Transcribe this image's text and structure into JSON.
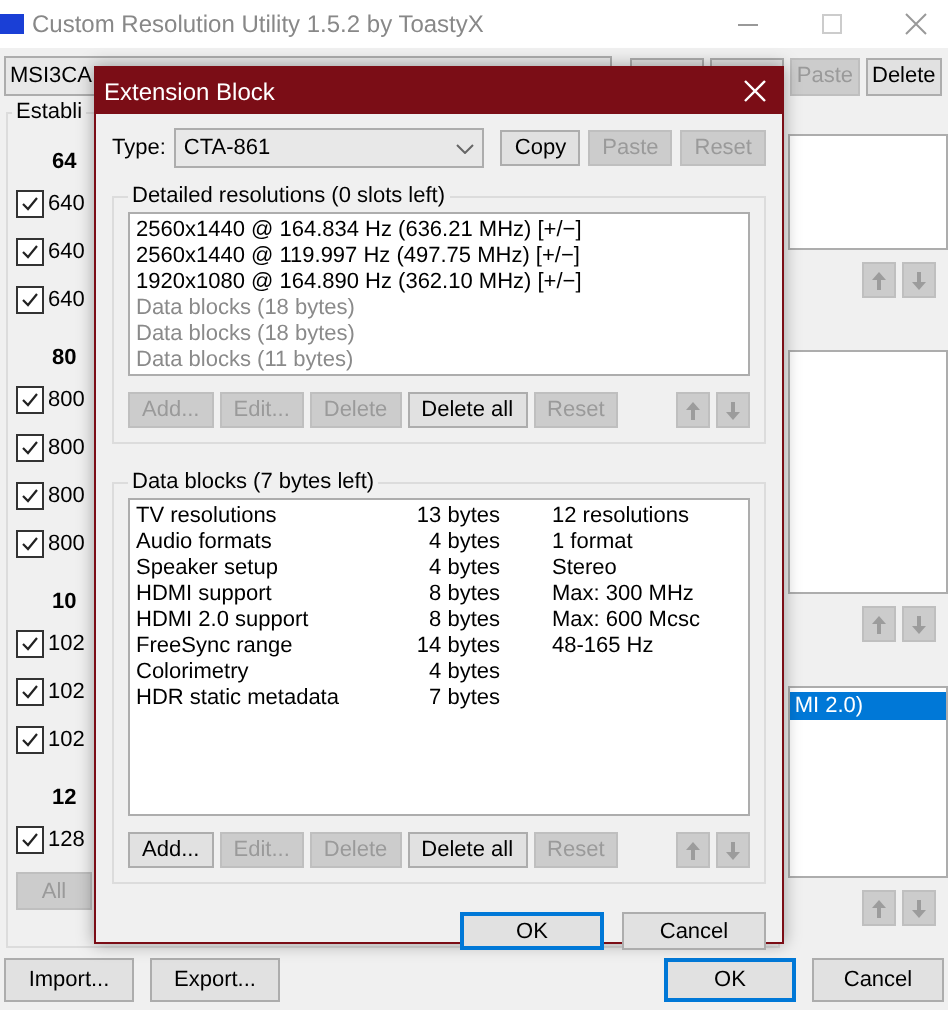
{
  "window": {
    "title": "Custom Resolution Utility 1.5.2 by ToastyX"
  },
  "toolbar": {
    "monitor": "MSI3CA",
    "buttons": [
      {
        "disabled": false
      },
      {
        "disabled": false
      },
      {
        "label": "Paste",
        "disabled": true
      },
      {
        "label": "Delete",
        "disabled": false
      }
    ]
  },
  "established": {
    "title": "Establi",
    "groups": [
      {
        "heading": "64",
        "items": [
          {
            "label": "640",
            "checked": true
          },
          {
            "label": "640",
            "checked": true
          },
          {
            "label": "640",
            "checked": true
          }
        ]
      },
      {
        "heading": "80",
        "items": [
          {
            "label": "800",
            "checked": true
          },
          {
            "label": "800",
            "checked": true
          },
          {
            "label": "800",
            "checked": true
          },
          {
            "label": "800",
            "checked": true
          }
        ]
      },
      {
        "heading": "10",
        "items": [
          {
            "label": "102",
            "checked": true
          },
          {
            "label": "102",
            "checked": true
          },
          {
            "label": "102",
            "checked": true
          }
        ]
      },
      {
        "heading": "12",
        "items": [
          {
            "label": "128",
            "checked": true
          }
        ]
      }
    ],
    "all_button": {
      "label": "All",
      "disabled": true
    }
  },
  "right_panel": {
    "extension_blocks": [
      {
        "label": "MI 2.0)",
        "selected": true
      }
    ]
  },
  "dialog": {
    "title": "Extension Block",
    "type": {
      "label": "Type:",
      "value": "CTA-861",
      "buttons": [
        {
          "label": "Copy",
          "disabled": false
        },
        {
          "label": "Paste",
          "disabled": true
        },
        {
          "label": "Reset",
          "disabled": true
        }
      ]
    },
    "detailed": {
      "title": "Detailed resolutions (0 slots left)",
      "items": [
        {
          "text": "2560x1440 @ 164.834 Hz (636.21 MHz) [+/−]",
          "kind": "resolution"
        },
        {
          "text": "2560x1440 @ 119.997 Hz (497.75 MHz) [+/−]",
          "kind": "resolution"
        },
        {
          "text": "1920x1080 @ 164.890 Hz (362.10 MHz) [+/−]",
          "kind": "resolution"
        },
        {
          "text": "Data blocks (18 bytes)",
          "kind": "data"
        },
        {
          "text": "Data blocks (18 bytes)",
          "kind": "data"
        },
        {
          "text": "Data blocks (11 bytes)",
          "kind": "data"
        }
      ],
      "buttons": [
        {
          "label": "Add...",
          "disabled": true
        },
        {
          "label": "Edit...",
          "disabled": true
        },
        {
          "label": "Delete",
          "disabled": true
        },
        {
          "label": "Delete all",
          "disabled": false
        },
        {
          "label": "Reset",
          "disabled": true
        }
      ],
      "arrows": [
        {
          "kind": "up",
          "disabled": true
        },
        {
          "kind": "down",
          "disabled": true
        }
      ]
    },
    "data_blocks": {
      "title": "Data blocks (7 bytes left)",
      "rows": [
        {
          "name": "TV resolutions",
          "size": "13 bytes",
          "info": "12 resolutions"
        },
        {
          "name": "Audio formats",
          "size": "4 bytes",
          "info": "1 format"
        },
        {
          "name": "Speaker setup",
          "size": "4 bytes",
          "info": "Stereo"
        },
        {
          "name": "HDMI support",
          "size": "8 bytes",
          "info": "Max: 300 MHz"
        },
        {
          "name": "HDMI 2.0 support",
          "size": "8 bytes",
          "info": "Max: 600 Mcsc"
        },
        {
          "name": "FreeSync range",
          "size": "14 bytes",
          "info": "48-165 Hz"
        },
        {
          "name": "Colorimetry",
          "size": "4 bytes"
        },
        {
          "name": "HDR static metadata",
          "size": "7 bytes"
        }
      ],
      "buttons": [
        {
          "label": "Add...",
          "disabled": false
        },
        {
          "label": "Edit...",
          "disabled": true
        },
        {
          "label": "Delete",
          "disabled": true
        },
        {
          "label": "Delete all",
          "disabled": false
        },
        {
          "label": "Reset",
          "disabled": true
        }
      ],
      "arrows": [
        {
          "kind": "up",
          "disabled": true
        },
        {
          "kind": "down",
          "disabled": true
        }
      ]
    },
    "buttons": [
      {
        "label": "OK",
        "default": true
      },
      {
        "label": "Cancel",
        "default": false
      }
    ]
  },
  "footer": {
    "left": [
      {
        "label": "Import..."
      },
      {
        "label": "Export..."
      }
    ],
    "right": [
      {
        "label": "OK",
        "default": true
      },
      {
        "label": "Cancel",
        "default": false
      }
    ],
    "arrows": [
      {
        "kind": "up",
        "disabled": true
      },
      {
        "kind": "down",
        "disabled": true
      }
    ]
  }
}
